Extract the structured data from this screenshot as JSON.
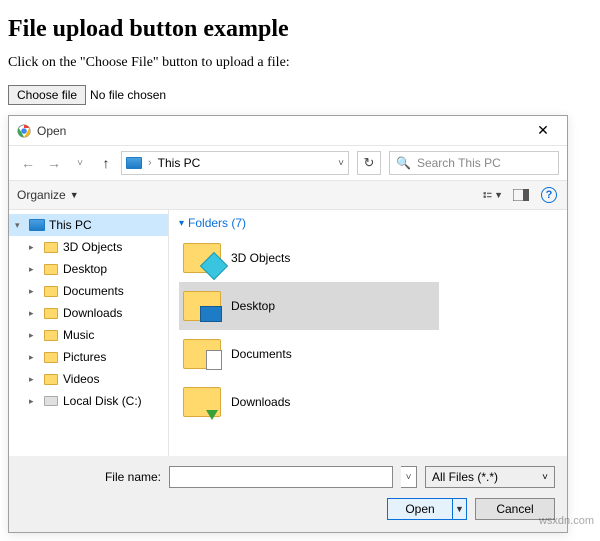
{
  "page": {
    "heading": "File upload button example",
    "intro": "Click on the \"Choose File\" button to upload a file:",
    "choose_label": "Choose file",
    "no_file_text": "No file chosen"
  },
  "dialog": {
    "title": "Open",
    "address_text": "This PC",
    "search_placeholder": "Search This PC",
    "organize_label": "Organize",
    "group_header": "Folders (7)",
    "filename_label": "File name:",
    "filter_label": "All Files (*.*)",
    "open_label": "Open",
    "cancel_label": "Cancel"
  },
  "sidebar": {
    "root": "This PC",
    "items": [
      {
        "label": "3D Objects"
      },
      {
        "label": "Desktop"
      },
      {
        "label": "Documents"
      },
      {
        "label": "Downloads"
      },
      {
        "label": "Music"
      },
      {
        "label": "Pictures"
      },
      {
        "label": "Videos"
      },
      {
        "label": "Local Disk (C:)"
      }
    ]
  },
  "folders": [
    {
      "label": "3D Objects"
    },
    {
      "label": "Desktop"
    },
    {
      "label": "Documents"
    },
    {
      "label": "Downloads"
    }
  ],
  "watermark": "wsxdn.com"
}
